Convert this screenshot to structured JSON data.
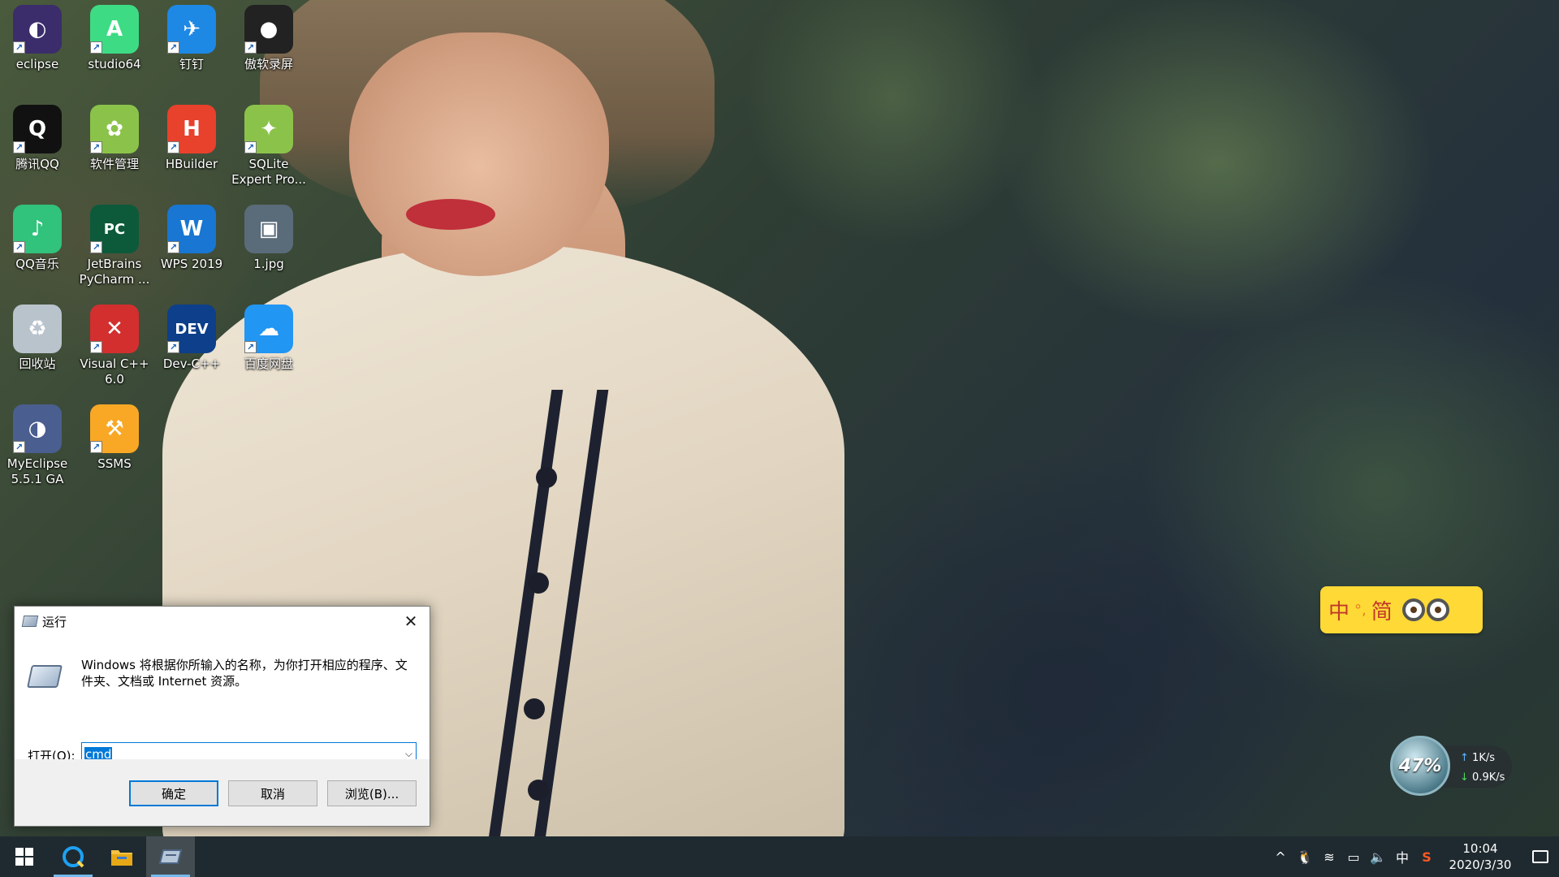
{
  "desktop": {
    "icons": [
      {
        "label": "eclipse",
        "glyph": "◐",
        "color": "#3b2d6b",
        "shortcut": true
      },
      {
        "label": "studio64",
        "glyph": "A",
        "color": "#3ddc84",
        "shortcut": true
      },
      {
        "label": "钉钉",
        "glyph": "✈",
        "color": "#1e88e5",
        "shortcut": true
      },
      {
        "label": "傲软录屏",
        "glyph": "●",
        "color": "#222222",
        "shortcut": true
      },
      {
        "label": "腾讯QQ",
        "glyph": "Q",
        "color": "#111111",
        "shortcut": true
      },
      {
        "label": "软件管理",
        "glyph": "✿",
        "color": "#8bc34a",
        "shortcut": true
      },
      {
        "label": "HBuilder",
        "glyph": "H",
        "color": "#e8412c",
        "shortcut": true
      },
      {
        "label": "SQLite Expert Pro...",
        "glyph": "✦",
        "color": "#8bc34a",
        "shortcut": true
      },
      {
        "label": "QQ音乐",
        "glyph": "♪",
        "color": "#31c27c",
        "shortcut": true
      },
      {
        "label": "JetBrains PyCharm ...",
        "glyph": "PC",
        "color": "#0c5a3a",
        "shortcut": true
      },
      {
        "label": "WPS 2019",
        "glyph": "W",
        "color": "#1976d2",
        "shortcut": true
      },
      {
        "label": "1.jpg",
        "glyph": "▣",
        "color": "#5a6b7a",
        "shortcut": false
      },
      {
        "label": "回收站",
        "glyph": "♻",
        "color": "#b9c3cc",
        "shortcut": false
      },
      {
        "label": "Visual C++ 6.0",
        "glyph": "✕",
        "color": "#d32f2f",
        "shortcut": true
      },
      {
        "label": "Dev-C++",
        "glyph": "DEV",
        "color": "#0d3f8a",
        "shortcut": true
      },
      {
        "label": "百度网盘",
        "glyph": "☁",
        "color": "#2196f3",
        "shortcut": true
      },
      {
        "label": "MyEclipse 5.5.1 GA",
        "glyph": "◑",
        "color": "#4a5e8f",
        "shortcut": true
      },
      {
        "label": "SSMS",
        "glyph": "⚒",
        "color": "#f9a825",
        "shortcut": true
      }
    ]
  },
  "run_dialog": {
    "title": "运行",
    "close_glyph": "✕",
    "description": "Windows 将根据你所输入的名称，为你打开相应的程序、文件夹、文档或 Internet 资源。",
    "open_label": "打开(O):",
    "input_value": "cmd",
    "dropdown_glyph": "⌵",
    "buttons": {
      "ok": "确定",
      "cancel": "取消",
      "browse": "浏览(B)..."
    }
  },
  "ime": {
    "mode": "中",
    "punct": "°,",
    "charset": "简"
  },
  "netmon": {
    "percent": "47%",
    "up": "1K/s",
    "down": "0.9K/s"
  },
  "taskbar": {
    "tray_icons": [
      "^",
      "🐧",
      "≋",
      "▭",
      "🔈",
      "中",
      "S"
    ],
    "time": "10:04",
    "date": "2020/3/30"
  }
}
